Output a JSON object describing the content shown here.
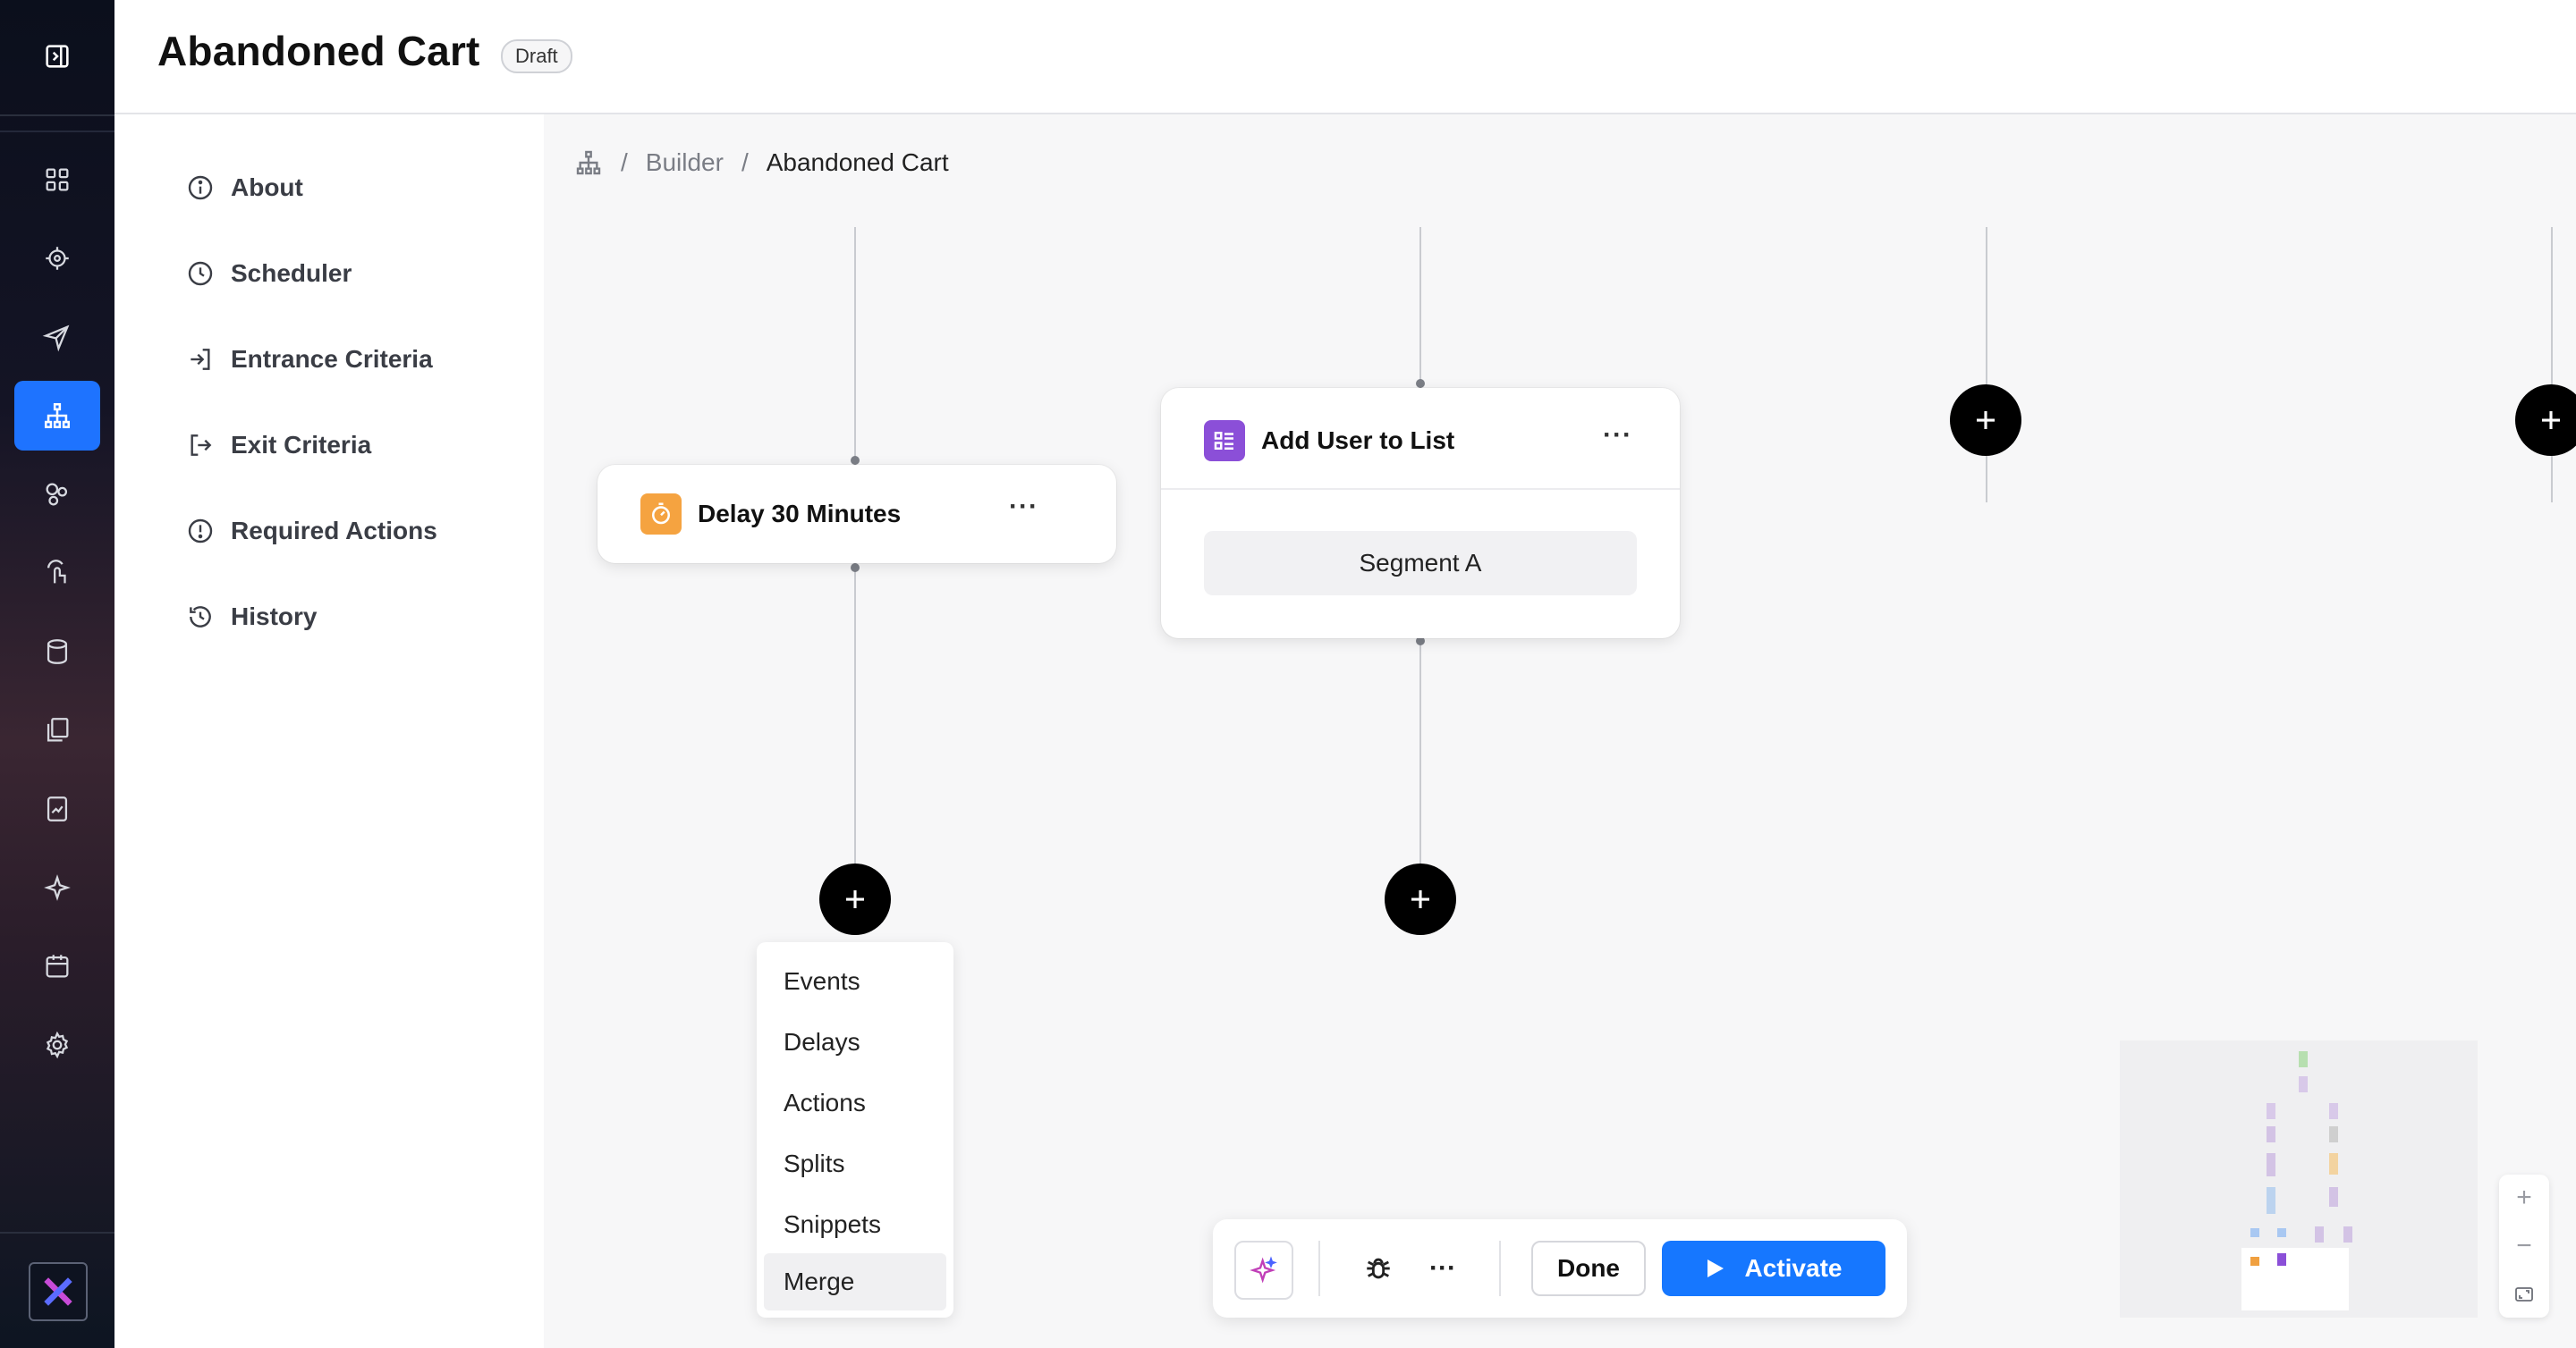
{
  "header": {
    "title": "Abandoned Cart",
    "status_badge": "Draft"
  },
  "rail": {
    "icons": [
      "panel-collapse-icon",
      "dashboard-icon",
      "target-icon",
      "send-icon",
      "journey-icon",
      "segments-icon",
      "touch-icon",
      "database-icon",
      "templates-icon",
      "reports-icon",
      "ai-sparkle-icon",
      "calendar-icon",
      "settings-icon",
      "app-logo"
    ],
    "active": "journey-icon"
  },
  "side_menu": {
    "items": [
      {
        "label": "About",
        "icon": "info-icon"
      },
      {
        "label": "Scheduler",
        "icon": "clock-icon"
      },
      {
        "label": "Entrance Criteria",
        "icon": "enter-icon"
      },
      {
        "label": "Exit Criteria",
        "icon": "exit-icon"
      },
      {
        "label": "Required Actions",
        "icon": "alert-circle-icon"
      },
      {
        "label": "History",
        "icon": "history-icon"
      }
    ]
  },
  "breadcrumb": {
    "sep": "/",
    "builder": "Builder",
    "current": "Abandoned Cart"
  },
  "nodes": {
    "delay": {
      "title": "Delay 30 Minutes",
      "menu": "···",
      "icon_color": "#f5a340"
    },
    "add_list": {
      "title": "Add User to List",
      "menu": "···",
      "segment": "Segment A",
      "icon_color": "#8b4fd8"
    }
  },
  "add_menu": {
    "items": [
      "Events",
      "Delays",
      "Actions",
      "Splits",
      "Snippets",
      "Merge"
    ],
    "highlighted": "Merge"
  },
  "toolbar": {
    "more": "···",
    "done_label": "Done",
    "activate_label": "Activate",
    "accent": "#1677ff"
  },
  "zoom": {
    "in": "+",
    "out": "−"
  }
}
